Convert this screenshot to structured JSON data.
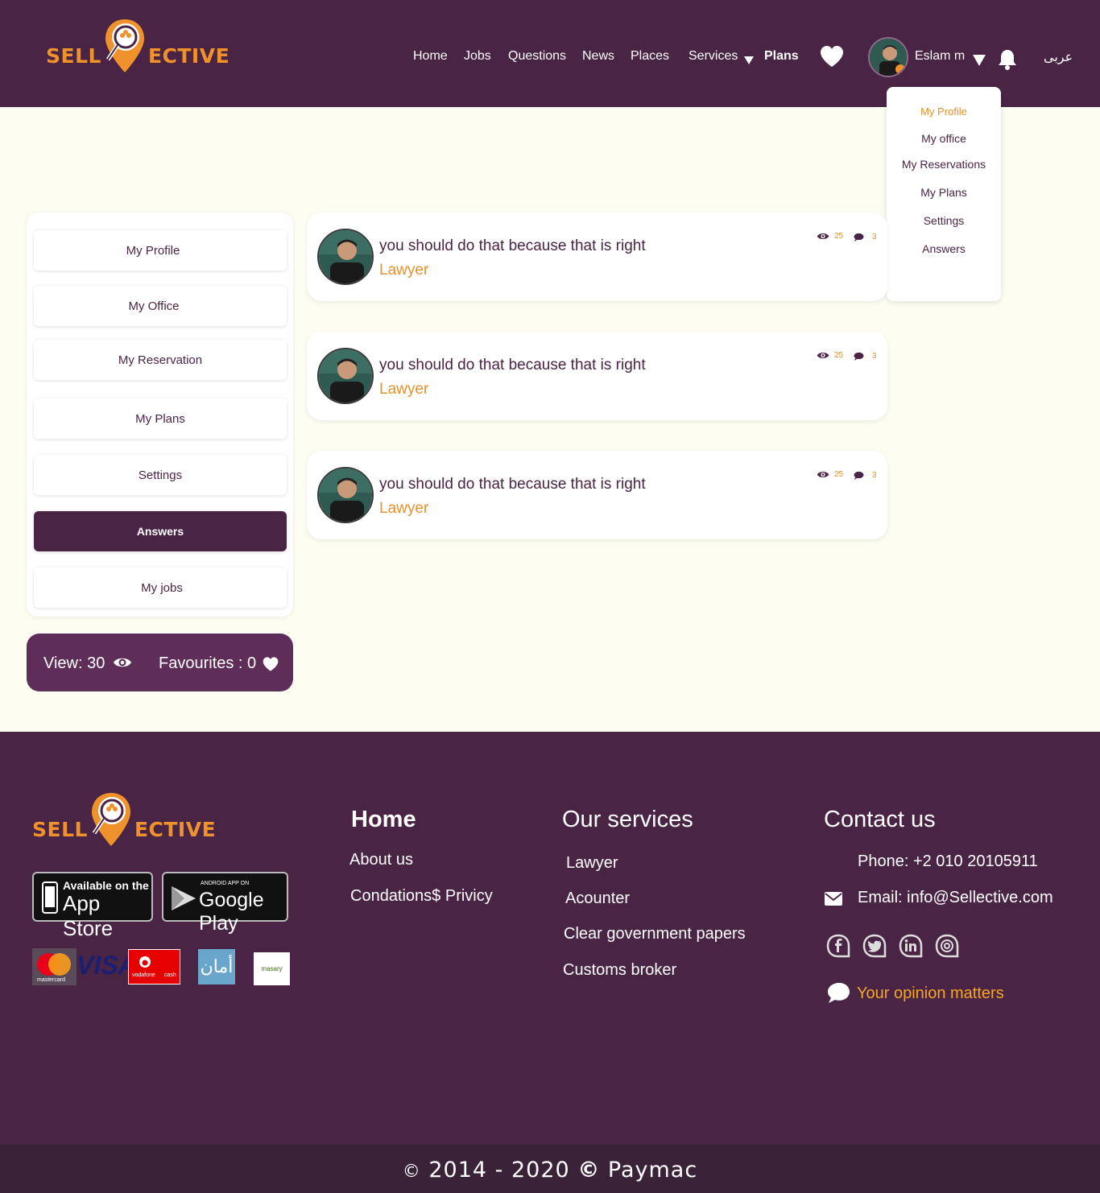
{
  "brand": {
    "left": "SELL",
    "right": "ECTIVE"
  },
  "nav": {
    "home": "Home",
    "jobs": "Jobs",
    "questions": "Questions",
    "news": "News",
    "places": "Places",
    "services": "Services",
    "plans": "Plans",
    "user_name": "Eslam m",
    "language": "عربى"
  },
  "user_menu": [
    "My Profile",
    "My office",
    "My Reservations",
    "My Plans",
    "Settings",
    "Answers"
  ],
  "sidebar": {
    "items": [
      "My Profile",
      "My Office",
      "My Reservation",
      "My Plans",
      "Settings",
      "Answers",
      "My jobs"
    ],
    "active": "Answers"
  },
  "stats": {
    "views": "View: 30",
    "favourites": "Favourites :  0"
  },
  "answers": [
    {
      "text": "you should do that because that is right",
      "role": "Lawyer",
      "views": "25",
      "comments": "3"
    },
    {
      "text": "you should do that because that is right",
      "role": "Lawyer",
      "views": "25",
      "comments": "3"
    },
    {
      "text": "you should do that because that is right",
      "role": "Lawyer",
      "views": "25",
      "comments": "3"
    }
  ],
  "footer": {
    "store_apple_top": "Available on the",
    "store_apple_main": "App Store",
    "store_google_top": "ANDROID APP ON",
    "store_google_main": "Google Play",
    "pay_mastercard": "mastercard",
    "pay_visa": "VISA",
    "pay_vodafone_a": "vodafone",
    "pay_vodafone_b": "cash",
    "pay_aman": "أمان",
    "pay_masary": "masary",
    "home_heading": "Home",
    "home_links": [
      "About us",
      "Condations$ Privicy"
    ],
    "services_heading": "Our services",
    "services": [
      "Lawyer",
      "Acounter",
      "Clear government papers",
      "Customs broker"
    ],
    "contact_heading": "Contact us",
    "phone": "Phone: +2 010 20105911",
    "email": "Email: info@Sellective.com",
    "opinion": "Your opinion matters",
    "copyright": "2014 - 2020",
    "company": "Paymac"
  },
  "colors": {
    "primary": "#4a2445",
    "accent": "#e8902a",
    "page_bg": "#fefdf2"
  }
}
